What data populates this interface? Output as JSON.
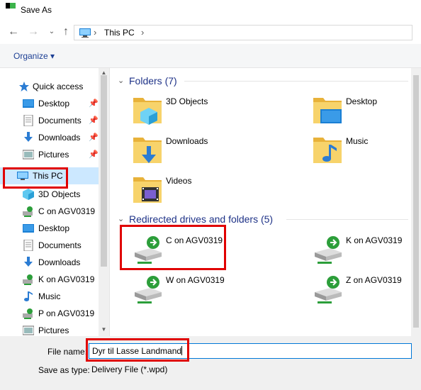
{
  "window": {
    "title": "Save As"
  },
  "nav": {
    "back_icon": "arrow-left-icon",
    "forward_icon": "arrow-right-icon",
    "recent_icon": "chevron-down-icon",
    "up_icon": "arrow-up-icon",
    "breadcrumb": "This PC"
  },
  "toolbar": {
    "organize_label": "Organize ▾"
  },
  "sidebar": {
    "items": [
      {
        "label": "Quick access",
        "icon": "star-icon"
      },
      {
        "label": "Desktop",
        "icon": "desktop-icon",
        "pinned": true
      },
      {
        "label": "Documents",
        "icon": "documents-icon",
        "pinned": true
      },
      {
        "label": "Downloads",
        "icon": "download-icon",
        "pinned": true
      },
      {
        "label": "Pictures",
        "icon": "pictures-icon",
        "pinned": true
      },
      {
        "label": "This PC",
        "icon": "computer-icon",
        "selected": true
      },
      {
        "label": "3D Objects",
        "icon": "cube-icon"
      },
      {
        "label": "C on AGV0319",
        "icon": "network-drive-icon"
      },
      {
        "label": "Desktop",
        "icon": "desktop-icon"
      },
      {
        "label": "Documents",
        "icon": "documents-icon"
      },
      {
        "label": "Downloads",
        "icon": "download-icon"
      },
      {
        "label": "K on AGV0319",
        "icon": "network-drive-icon"
      },
      {
        "label": "Music",
        "icon": "music-icon"
      },
      {
        "label": "P on AGV0319",
        "icon": "network-drive-icon"
      },
      {
        "label": "Pictures",
        "icon": "pictures-icon"
      }
    ]
  },
  "content": {
    "folders_header": "Folders (7)",
    "folders": [
      {
        "label": "3D Objects",
        "icon": "cube-folder-icon"
      },
      {
        "label": "Desktop",
        "icon": "desktop-folder-icon"
      },
      {
        "label": "Downloads",
        "icon": "download-folder-icon"
      },
      {
        "label": "Music",
        "icon": "music-folder-icon"
      },
      {
        "label": "Videos",
        "icon": "videos-folder-icon"
      }
    ],
    "drives_header": "Redirected drives and folders (5)",
    "drives": [
      {
        "label": "C on AGV0319",
        "icon": "network-drive-icon"
      },
      {
        "label": "K on AGV0319",
        "icon": "network-drive-icon"
      },
      {
        "label": "W on AGV0319",
        "icon": "network-drive-icon"
      },
      {
        "label": "Z on AGV0319",
        "icon": "network-drive-icon"
      }
    ]
  },
  "form": {
    "file_name_label": "File name:",
    "file_name_value": "Dyr til Lasse Landmand",
    "save_type_label": "Save as type:",
    "save_type_value": "Delivery File (*.wpd)"
  },
  "colors": {
    "highlight": "#e00000",
    "selection": "#cce8ff",
    "group_header": "#1e3287",
    "organize": "#1c3f94",
    "folder": "#f3c54a"
  }
}
